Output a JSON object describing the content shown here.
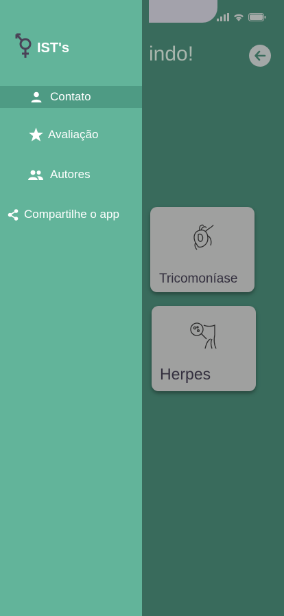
{
  "app": {
    "logo_text": "IST's"
  },
  "drawer": {
    "items": [
      {
        "label": "Contato",
        "icon": "person-icon",
        "active": true
      },
      {
        "label": "Avaliação",
        "icon": "star-icon",
        "active": false
      },
      {
        "label": "Autores",
        "icon": "group-icon",
        "active": false
      },
      {
        "label": "Compartilhe o app",
        "icon": "share-icon",
        "active": false
      }
    ]
  },
  "main": {
    "greeting_partial": "indo!",
    "cards": [
      {
        "label": "Tricomoníase",
        "icon": "trichomonas-icon"
      },
      {
        "label": "Herpes",
        "icon": "herpes-icon"
      }
    ]
  },
  "colors": {
    "drawer_bg": "#62b49a",
    "drawer_active": "#4e9b84",
    "main_bg": "#396b5c",
    "card_bg": "#9fa09f",
    "text_dark": "#332f3e"
  }
}
